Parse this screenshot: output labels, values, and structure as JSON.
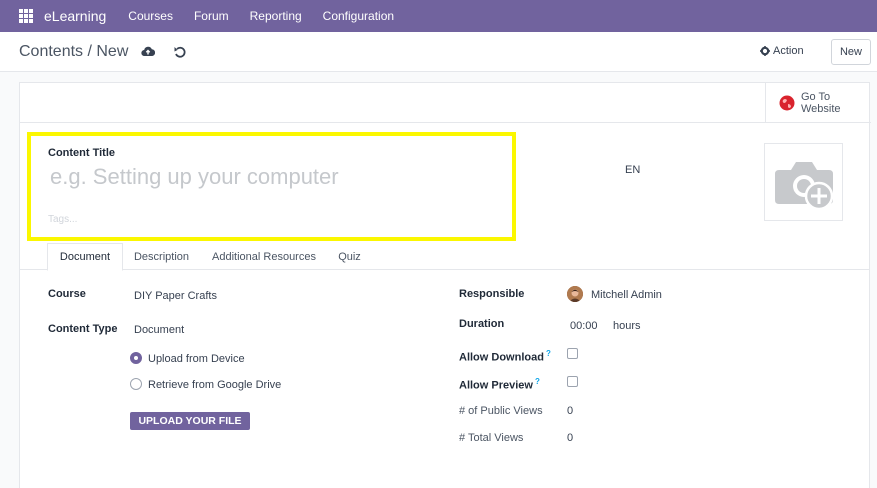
{
  "nav": {
    "brand": "eLearning",
    "items": [
      "Courses",
      "Forum",
      "Reporting",
      "Configuration"
    ]
  },
  "control": {
    "breadcrumb": "Contents / New",
    "action_label": "Action",
    "new_label": "New"
  },
  "sheet": {
    "goto_website": "Go To\nWebsite",
    "content_title_label": "Content Title",
    "title_placeholder": "e.g. Setting up your computer",
    "tags_placeholder": "Tags...",
    "language": "EN"
  },
  "tabs": [
    "Document",
    "Description",
    "Additional Resources",
    "Quiz"
  ],
  "fields": {
    "course_label": "Course",
    "course_value": "DIY Paper Crafts",
    "content_type_label": "Content Type",
    "content_type_value": "Document",
    "radio_upload": "Upload from Device",
    "radio_drive": "Retrieve from Google Drive",
    "upload_button": "UPLOAD YOUR FILE",
    "responsible_label": "Responsible",
    "responsible_value": "Mitchell Admin",
    "duration_label": "Duration",
    "duration_value": "00:00",
    "duration_unit": "hours",
    "allow_download_label": "Allow Download",
    "allow_preview_label": "Allow Preview",
    "help_mark": "?",
    "public_views_label": "# of Public Views",
    "public_views_value": "0",
    "total_views_label": "# Total Views",
    "total_views_value": "0"
  },
  "colors": {
    "brand": "#71639e",
    "highlight": "#fbf700",
    "globe": "#d9232d"
  }
}
